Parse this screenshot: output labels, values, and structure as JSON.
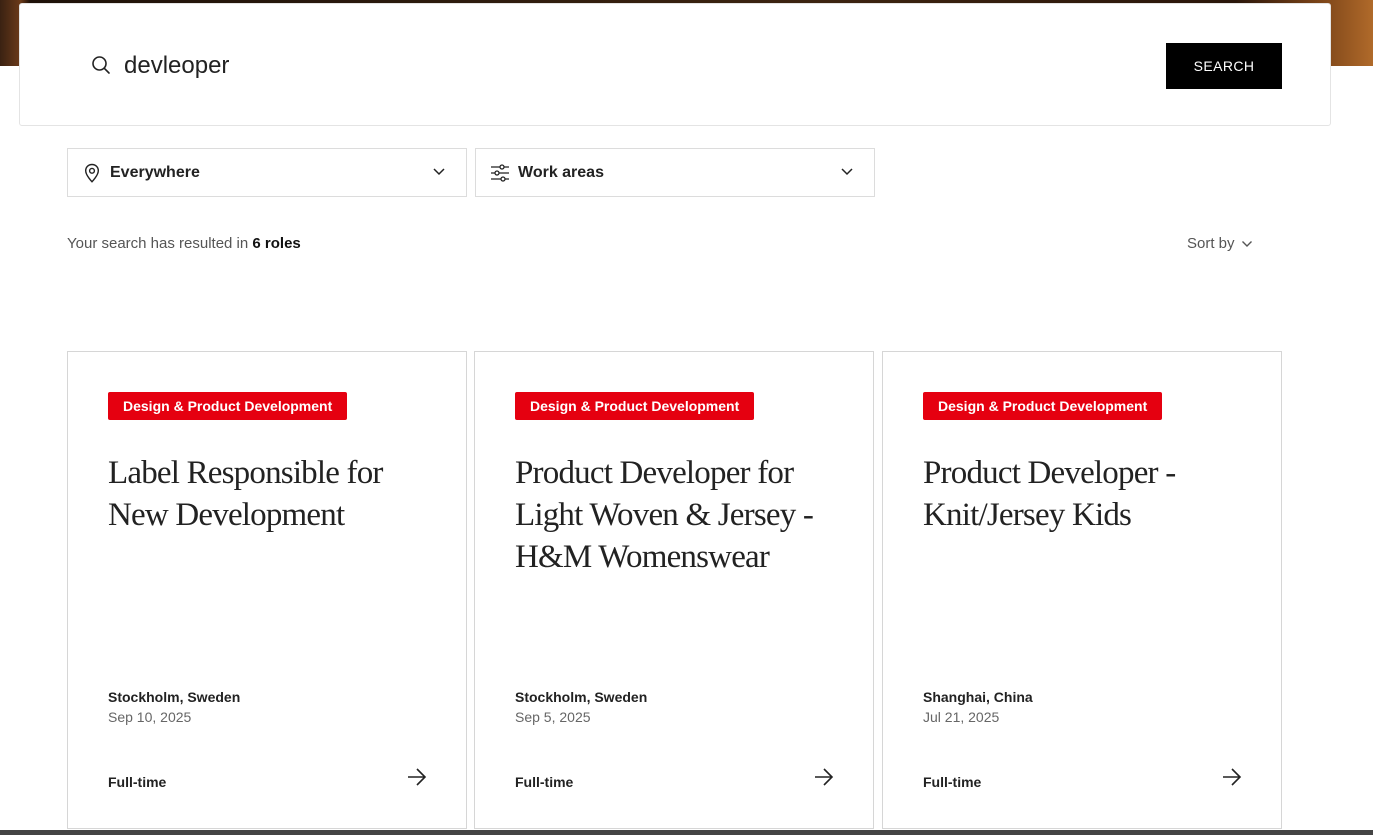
{
  "search": {
    "value": "devleoper",
    "button_label": "SEARCH"
  },
  "filters": {
    "location_label": "Everywhere",
    "work_areas_label": "Work areas"
  },
  "results": {
    "prefix": "Your search has resulted in ",
    "count_label": "6 roles"
  },
  "sort": {
    "label": "Sort by"
  },
  "jobs": [
    {
      "category": "Design & Product Development",
      "title": "Label Responsible for New Development",
      "location": "Stockholm, Sweden",
      "date": "Sep 10, 2025",
      "type": "Full-time"
    },
    {
      "category": "Design & Product Development",
      "title": "Product Developer for Light Woven & Jersey - H&M Womenswear",
      "location": "Stockholm, Sweden",
      "date": "Sep 5, 2025",
      "type": "Full-time"
    },
    {
      "category": "Design & Product Development",
      "title": "Product Developer - Knit/Jersey Kids",
      "location": "Shanghai, China",
      "date": "Jul 21, 2025",
      "type": "Full-time"
    }
  ],
  "colors": {
    "badge": "#e50010",
    "button": "#000000"
  }
}
